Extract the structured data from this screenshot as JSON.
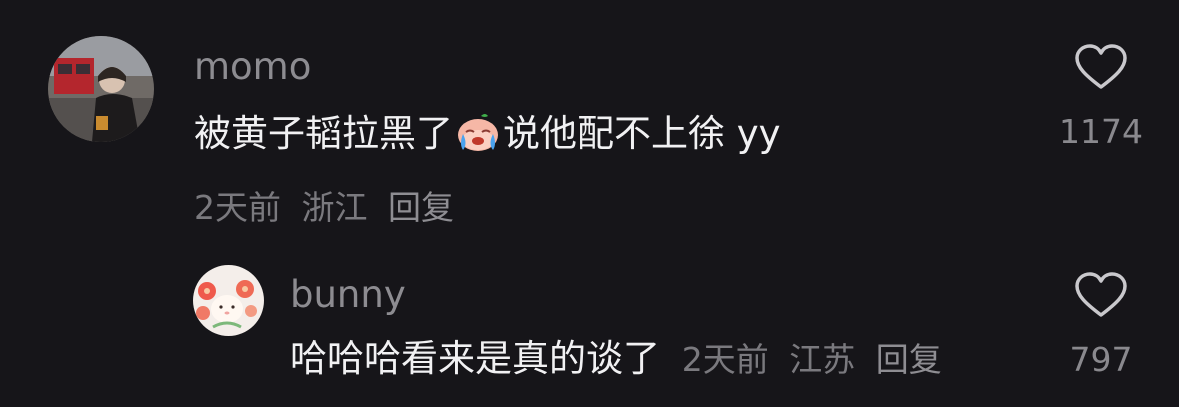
{
  "comments": [
    {
      "username": "momo",
      "text_before": "被黄子韬拉黑了",
      "emoji": "crying-face-emoji",
      "text_after": "说他配不上徐 yy",
      "time": "2天前",
      "location": "浙江",
      "reply_label": "回复",
      "likes": "1174"
    },
    {
      "username": "bunny",
      "text": "哈哈哈看来是真的谈了",
      "time": "2天前",
      "location": "江苏",
      "reply_label": "回复",
      "likes": "797"
    }
  ],
  "colors": {
    "background": "#161519",
    "text": "#f1f1f3",
    "secondary": "#8d8c91"
  }
}
